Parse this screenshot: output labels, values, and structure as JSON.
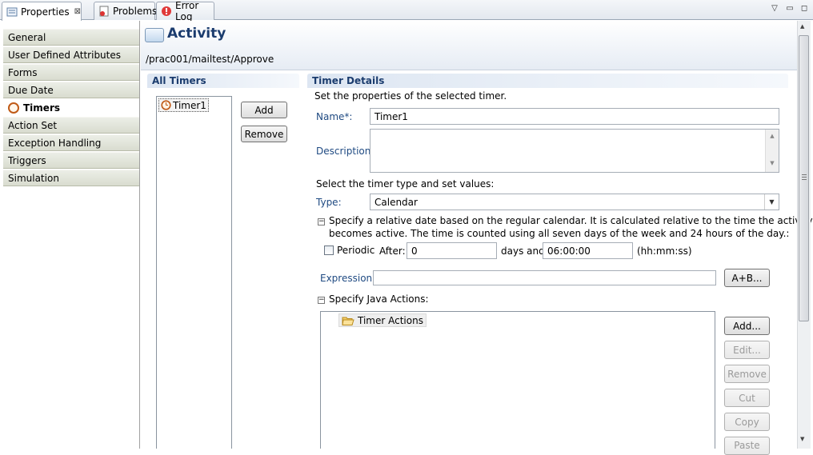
{
  "view_tabs": [
    {
      "label": "Properties",
      "close": "⊠"
    },
    {
      "label": "Problems"
    },
    {
      "label": "Error Log"
    }
  ],
  "side_tabs": [
    {
      "label": "General"
    },
    {
      "label": "User Defined Attributes"
    },
    {
      "label": "Forms"
    },
    {
      "label": "Due Date"
    },
    {
      "label": "Timers"
    },
    {
      "label": "Action Set"
    },
    {
      "label": "Exception Handling"
    },
    {
      "label": "Triggers"
    },
    {
      "label": "Simulation"
    }
  ],
  "header": {
    "title": "Activity",
    "path": "/prac001/mailtest/Approve"
  },
  "all_timers": {
    "title": "All Timers",
    "items": [
      "Timer1"
    ],
    "add_label": "Add",
    "remove_label": "Remove"
  },
  "timer_details": {
    "title": "Timer Details",
    "instruction": "Set the properties of the selected timer.",
    "name_label": "Name*:",
    "name_value": "Timer1",
    "description_label": "Description:",
    "description_value": "",
    "type_instruction": "Select the timer type and set values:",
    "type_label": "Type:",
    "type_value": "Calendar",
    "calendar_text_1": "Specify a relative date based on the regular calendar. It is calculated relative to the time the activity",
    "calendar_text_2": "becomes active. The time is counted using all seven days of the week and 24 hours of the day.:",
    "periodic_label": "Periodic",
    "after_label": "After:",
    "after_value": "0",
    "days_and_label": "days and",
    "time_value": "06:00:00",
    "time_format": "(hh:mm:ss)",
    "expression_label": "Expression:",
    "expression_value": "",
    "expression_button": "A+B...",
    "java_actions_label": "Specify Java Actions:",
    "tree_root": "Timer Actions",
    "action_buttons": {
      "add": "Add...",
      "edit": "Edit...",
      "remove": "Remove",
      "cut": "Cut",
      "copy": "Copy",
      "paste": "Paste"
    }
  }
}
